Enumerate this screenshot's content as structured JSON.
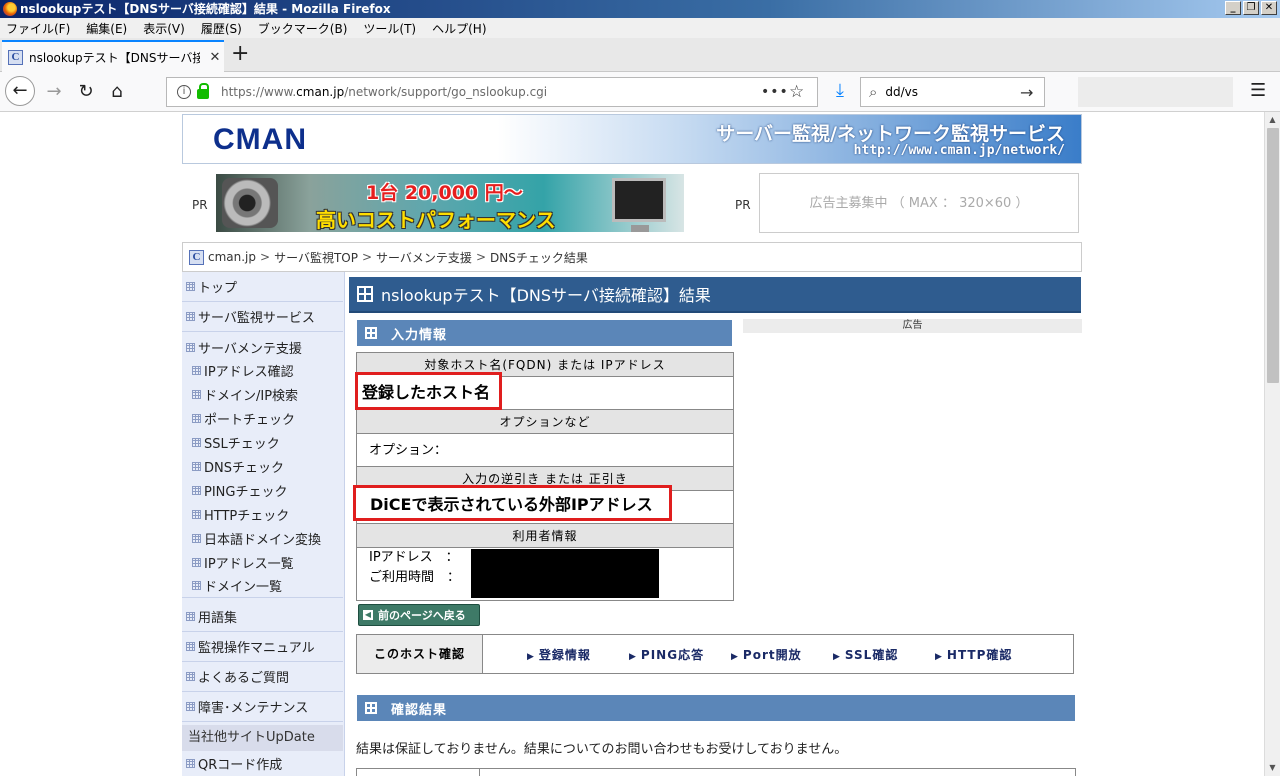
{
  "window": {
    "title": "nslookupテスト【DNSサーバ接続確認】結果 - Mozilla Firefox",
    "buttons": [
      "_",
      "❐",
      "✕"
    ]
  },
  "menu": [
    "ファイル(F)",
    "編集(E)",
    "表示(V)",
    "履歴(S)",
    "ブックマーク(B)",
    "ツール(T)",
    "ヘルプ(H)"
  ],
  "tab": {
    "favicon": "C",
    "title": "nslookupテスト【DNSサーバ接続確",
    "close": "✕"
  },
  "newtab": "+",
  "nav": {
    "back": "←",
    "forward": "→",
    "reload": "↻",
    "home": "⌂",
    "url_prefix": "https://www.",
    "url_domain": "cman.jp",
    "url_path": "/network/support/go_nslookup.cgi",
    "more": "•••",
    "star": "☆",
    "download": "⤓",
    "search_value": "dd/vs",
    "search_go": "→",
    "menu": "☰"
  },
  "header": {
    "logo": "CMAN",
    "tagline": "サーバー監視/ネットワーク監視サービス",
    "site_url": "http://www.cman.jp/network/"
  },
  "ads": {
    "pr_left": "PR",
    "pr_right": "PR",
    "banner_line1": "1台 20,000 円～",
    "banner_line2": "高いコストパフォーマンス",
    "right_text": "広告主募集中 （ MAX ： 320×60 ）",
    "side_label": "広告"
  },
  "breadcrumb": {
    "icon": "C",
    "items": [
      "cman.jp",
      "サーバ監視TOP",
      "サーバメンテ支援",
      "DNSチェック結果"
    ],
    "sep": ">"
  },
  "sidebar": {
    "top_items": [
      "トップ",
      "サーバ監視サービス",
      "サーバメンテ支援"
    ],
    "sub_items": [
      "IPアドレス確認",
      "ドメイン/IP検索",
      "ポートチェック",
      "SSLチェック",
      "DNSチェック",
      "PINGチェック",
      "HTTPチェック",
      "日本語ドメイン変換",
      "IPアドレス一覧",
      "ドメイン一覧"
    ],
    "bottom_items": [
      "用語集",
      "監視操作マニュアル",
      "よくあるご質問",
      "障害･メンテナンス"
    ],
    "section_head": "当社他サイトUpDate",
    "section_items": [
      "QRコード作成"
    ]
  },
  "main": {
    "title": "nslookupテスト【DNSサーバ接続確認】結果",
    "input_section": "入力情報",
    "target_host_head": "対象ホスト名(FQDN) または IPアドレス",
    "target_host_value": "登録したホスト名",
    "option_head": "オプションなど",
    "option_label": "オプション：",
    "reverse_head": "入力の逆引き または 正引き",
    "reverse_value": "DiCEで表示されている外部IPアドレス",
    "user_head": "利用者情報",
    "user_ip_label": "IPアドレス　：",
    "user_time_label": "ご利用時間　：",
    "back_button": "前のページへ戻る",
    "host_check_label": "このホスト確認",
    "host_check_links": [
      "登録情報",
      "PING応答",
      "Port開放",
      "SSL確認",
      "HTTP確認"
    ],
    "result_section": "確認結果",
    "result_note": "結果は保証しておりません。結果についてのお問い合わせもお受けしておりません。"
  },
  "colors": {
    "accent_dark": "#2f5c8f",
    "accent_mid": "#5b86b8",
    "annotation_red": "#e01e1e",
    "sidebar_bg": "#e8edf9"
  }
}
